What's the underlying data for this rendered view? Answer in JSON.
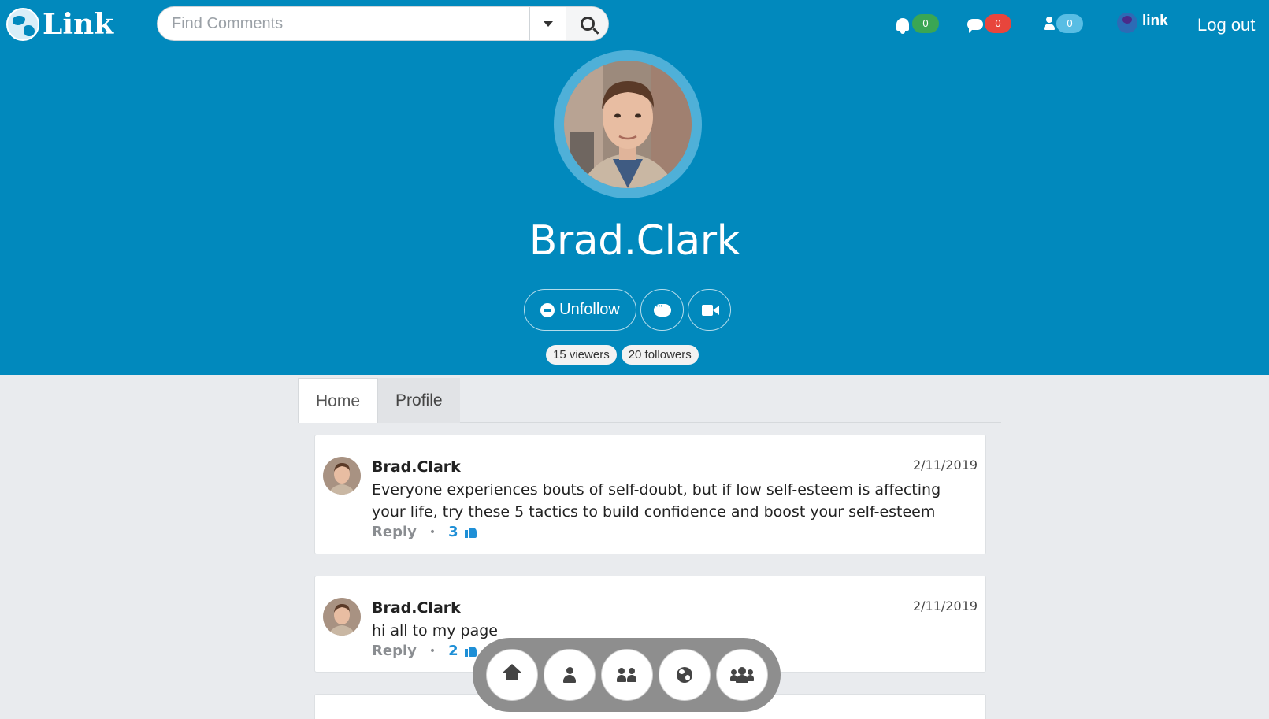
{
  "app": {
    "logo_text": "Link"
  },
  "search": {
    "placeholder": "Find Comments"
  },
  "nav": {
    "notifications": {
      "icon": "bell-icon",
      "count": "0",
      "color": "#3aa654"
    },
    "messages": {
      "icon": "comment-icon",
      "count": "0",
      "color": "#e8453c"
    },
    "friend_requests": {
      "icon": "user-icon",
      "count": "0",
      "color": "#58bde4"
    },
    "current_user": "link",
    "logout": "Log out"
  },
  "profile": {
    "name": "Brad.Clark",
    "unfollow_label": "Unfollow",
    "viewers": "15 viewers",
    "followers": "20 followers"
  },
  "tabs": [
    {
      "label": "Home",
      "active": true
    },
    {
      "label": "Profile",
      "active": false
    }
  ],
  "posts": [
    {
      "author": "Brad.Clark",
      "date": "2/11/2019",
      "text": "Everyone experiences bouts of self-doubt, but if low self-esteem is affecting your life, try these 5 tactics to build confidence and boost your self-esteem",
      "reply_label": "Reply",
      "likes": "3"
    },
    {
      "author": "Brad.Clark",
      "date": "2/11/2019",
      "text": "hi all to my page",
      "reply_label": "Reply",
      "likes": "2"
    }
  ],
  "bottom_nav": [
    "home-icon",
    "user-icon",
    "users-icon",
    "globe-icon",
    "group-icon"
  ],
  "colors": {
    "brand": "#0189bd",
    "background": "#e9ebee",
    "like": "#1e8fd6"
  }
}
